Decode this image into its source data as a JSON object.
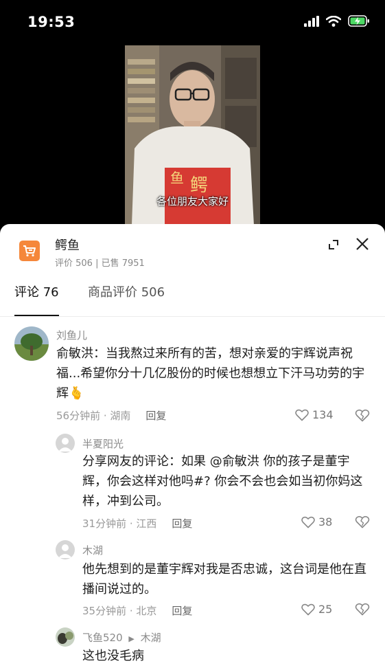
{
  "status_bar": {
    "time": "19:53"
  },
  "video": {
    "subtitle": "各位朋友大家好",
    "book_title": "鳄鱼"
  },
  "product": {
    "title": "鳄鱼",
    "meta": "评价 506 | 已售 7951"
  },
  "tabs": [
    {
      "label": "评论 76"
    },
    {
      "label": "商品评价 506"
    }
  ],
  "comments": [
    {
      "username": "刘鱼儿",
      "text": "俞敏洪：当我熬过来所有的苦，想对亲爱的宇辉说声祝福...希望你分十几亿股份的时候也想想立下汗马功劳的宇辉",
      "emoji": "🫰",
      "meta": "56分钟前 · 湖南",
      "reply_label": "回复",
      "likes": "134"
    },
    {
      "username": "半夏阳光",
      "text": "分享网友的评论：如果 @俞敏洪 你的孩子是董宇辉，你会这样对他吗#? 你会不会也会如当初你妈这样，冲到公司。",
      "meta": "31分钟前 · 江西",
      "reply_label": "回复",
      "likes": "38"
    },
    {
      "username": "木湖",
      "text": "他先想到的是董宇辉对我是否忠诚，这台词是他在直播间说过的。",
      "meta": "35分钟前 · 北京",
      "reply_label": "回复",
      "likes": "25"
    },
    {
      "username": "飞鱼520",
      "reply_to": "木湖",
      "text": "这也没毛病"
    }
  ]
}
